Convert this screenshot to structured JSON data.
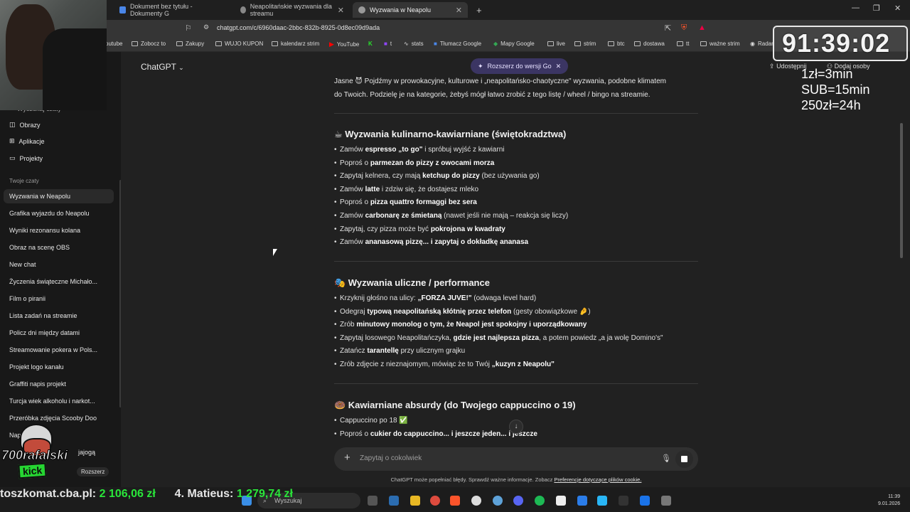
{
  "browser": {
    "tabs": [
      {
        "label": "Dokument bez tytułu - Dokumenty G"
      },
      {
        "label": "Neapolitańskie wyzwania dla streamu"
      },
      {
        "label": "Wyzwania w Neapolu"
      }
    ],
    "new_tab": "+",
    "url": "chatgpt.com/c/6960daac-2bbc-832b-8925-0d8ec09d9ada",
    "bookmarks": [
      "outube",
      "Zobocz to",
      "Zakupy",
      "WUJO KUPON",
      "kalendarz strim",
      "YouTube",
      "t",
      "stats",
      "Tłumacz Google",
      "Mapy Google",
      "live",
      "strim",
      "btc",
      "dostawa",
      "tt",
      "ważne strim",
      "Radar"
    ]
  },
  "sidebar": {
    "items": [
      {
        "label": "Wyszukaj czaty"
      },
      {
        "label": "Obrazy"
      },
      {
        "label": "Aplikacje"
      },
      {
        "label": "Projekty"
      }
    ],
    "section_title": "Twoje czaty",
    "chats": [
      "Wyzwania w Neapolu",
      "Grafika wyjazdu do Neapolu",
      "Wyniki rezonansu kolana",
      "Obraz na scenę OBS",
      "New chat",
      "Życzenia świąteczne Michało...",
      "Film o piranii",
      "Lista zadań na streamie",
      "Policz dni między datami",
      "Streamowanie pokera w Pols...",
      "Projekt logo kanału",
      "Graffiti napis projekt",
      "Turcja wiek alkoholu i narkot...",
      "Przeróbka zdjęcia Scooby Doo",
      "Napis od tyłu",
      "jajogą"
    ],
    "upgrade_label": "Rozszerz"
  },
  "header": {
    "model": "ChatGPT",
    "upgrade": "Rozszerz do wersji Go",
    "share": "Udostępnij",
    "add_people": "Dodaj osoby"
  },
  "message": {
    "intro_1": "Jasne 😈 Pojdźmy w prowokacyjne, kulturowe i „neapolitańsko-chaotyczne\" wyzwania, podobne klimatem",
    "intro_2": "do Twoich. Podzielę je na kategorie, żebyś mógł łatwo zrobić z tego listę / wheel / bingo na streamie.",
    "sections": [
      {
        "title": "☕ Wyzwania kulinarno-kawiarniane (świętokradztwa)",
        "items": [
          [
            "Zamów ",
            "espresso „to go\"",
            " i spróbuj wyjść z kawiarni"
          ],
          [
            "Poproś o ",
            "parmezan do pizzy z owocami morza",
            ""
          ],
          [
            "Zapytaj kelnera, czy mają ",
            "ketchup do pizzy",
            " (bez używania go)"
          ],
          [
            "Zamów ",
            "latte",
            " i zdziw się, że dostajesz mleko"
          ],
          [
            "Poproś o ",
            "pizza quattro formaggi bez sera",
            ""
          ],
          [
            "Zamów ",
            "carbonarę ze śmietaną",
            " (nawet jeśli nie mają – reakcja się liczy)"
          ],
          [
            "Zapytaj, czy pizza może być ",
            "pokrojona w kwadraty",
            ""
          ],
          [
            "Zamów ",
            "ananasową pizzę... i zapytaj o dokładkę ananasa",
            ""
          ]
        ]
      },
      {
        "title": "🎭 Wyzwania uliczne / performance",
        "items": [
          [
            "Krzyknij głośno na ulicy: ",
            "„FORZA JUVE!\"",
            " (odwaga level hard)"
          ],
          [
            "Odegraj ",
            "typową neapolitańską kłótnię przez telefon",
            " (gesty obowiązkowe 🤌)"
          ],
          [
            "Zrób ",
            "minutowy monolog o tym, że Neapol jest spokojny i uporządkowany",
            ""
          ],
          [
            "Zapytaj losowego Neapolitańczyka, ",
            "gdzie jest najlepsza pizza",
            ", a potem powiedz „a ja wolę Domino's\""
          ],
          [
            "Zatańcz ",
            "tarantellę",
            " przy ulicznym grajku"
          ],
          [
            "Zrób zdjęcie z nieznajomym, mówiąc że to Twój ",
            "„kuzyn z Neapolu\"",
            ""
          ]
        ]
      },
      {
        "title": "🍩 Kawiarniane absurdy (do Twojego cappuccino o 19)",
        "items": [
          [
            "Cappuccino po 18 ✅",
            "",
            ""
          ],
          [
            "Poproś o ",
            "cukier do cappuccino... i jeszcze jeden... i jeszcze",
            ""
          ]
        ]
      }
    ]
  },
  "composer": {
    "placeholder": "Zapytaj o cokolwiek",
    "disclaimer": "ChatGPT może popełniać błędy. Sprawdź ważne informacje. Zobacz ",
    "disclaimer_link": "Preferencje dotyczące plików cookie."
  },
  "taskbar": {
    "search": "Wyszukaj",
    "time": "11:39",
    "date": "9.01.2026"
  },
  "overlay": {
    "timer": "91:39:02",
    "rates": [
      "1zł=3min",
      "SUB=15min",
      "250zł=24h"
    ],
    "ticker_left": "toszkomat.cba.pl:",
    "ticker_left_amount": "2 106,06 zł",
    "ticker_right": "4. Matieus:",
    "ticker_right_amount": "1 279,74 zł",
    "logo_name": "700rafalski",
    "logo_kick": "kick"
  },
  "colors": {
    "background": "#212121",
    "sidebar": "#181818",
    "accent_upgrade": "#3b3563",
    "ticker_green": "#2ae63a"
  }
}
